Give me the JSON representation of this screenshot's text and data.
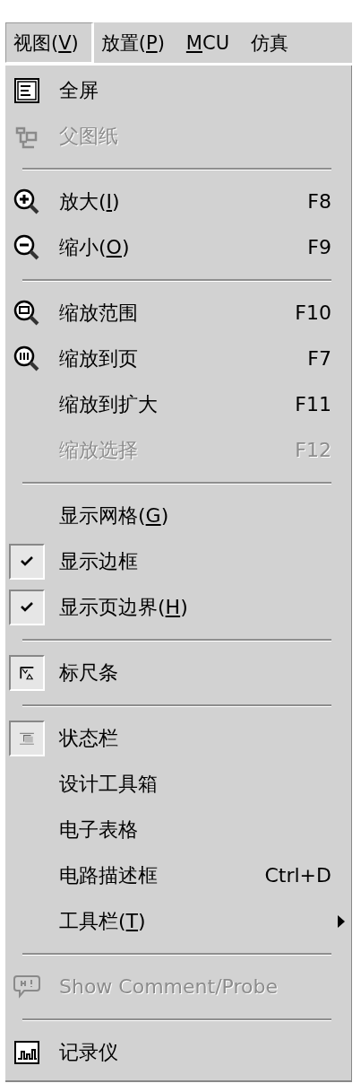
{
  "menu_bar": [
    {
      "label": "视图(",
      "mnemonic": "V",
      "label_end": ")",
      "selected": true
    },
    {
      "label": "放置(",
      "mnemonic": "P",
      "label_end": ")",
      "selected": false
    },
    {
      "mnemonic": "M",
      "label_end": "CU",
      "selected": false
    },
    {
      "label": "仿真",
      "selected": false
    }
  ],
  "menu": {
    "items": [
      {
        "kind": "item",
        "label": "全屏",
        "disabled": false
      },
      {
        "kind": "item",
        "label": "父图纸",
        "disabled": true
      },
      {
        "kind": "separator"
      },
      {
        "kind": "item",
        "label": "放大(",
        "mnemonic": "I",
        "label_end": ")",
        "shortcut": "F8",
        "disabled": false
      },
      {
        "kind": "item",
        "label": "缩小(",
        "mnemonic": "O",
        "label_end": ")",
        "shortcut": "F9",
        "disabled": false
      },
      {
        "kind": "separator"
      },
      {
        "kind": "item",
        "label": "缩放范围",
        "shortcut": "F10",
        "disabled": false
      },
      {
        "kind": "item",
        "label": "缩放到页",
        "shortcut": "F7",
        "disabled": false
      },
      {
        "kind": "item",
        "label": "缩放到扩大",
        "shortcut": "F11",
        "disabled": false
      },
      {
        "kind": "item",
        "label": "缩放选择",
        "shortcut": "F12",
        "disabled": true
      },
      {
        "kind": "separator"
      },
      {
        "kind": "item",
        "label": "显示网格(",
        "mnemonic": "G",
        "label_end": ")",
        "checked": false,
        "disabled": false
      },
      {
        "kind": "item",
        "label": "显示边框",
        "checked": true,
        "disabled": false
      },
      {
        "kind": "item",
        "label": "显示页边界(",
        "mnemonic": "H",
        "label_end": ")",
        "checked": true,
        "disabled": false
      },
      {
        "kind": "separator"
      },
      {
        "kind": "item",
        "label": "标尺条",
        "checked": true,
        "disabled": false
      },
      {
        "kind": "separator"
      },
      {
        "kind": "item",
        "label": "状态栏",
        "checked": true,
        "disabled": false
      },
      {
        "kind": "item",
        "label": "设计工具箱",
        "disabled": false
      },
      {
        "kind": "item",
        "label": "电子表格",
        "disabled": false
      },
      {
        "kind": "item",
        "label": "电路描述框",
        "shortcut": "Ctrl+D",
        "disabled": false
      },
      {
        "kind": "item",
        "label": "工具栏(",
        "mnemonic": "T",
        "label_end": ")",
        "submenu": true,
        "disabled": false
      },
      {
        "kind": "separator"
      },
      {
        "kind": "item",
        "label": "Show Comment/Probe",
        "disabled": true
      },
      {
        "kind": "separator"
      },
      {
        "kind": "item",
        "label": "记录仪",
        "disabled": false
      }
    ]
  }
}
